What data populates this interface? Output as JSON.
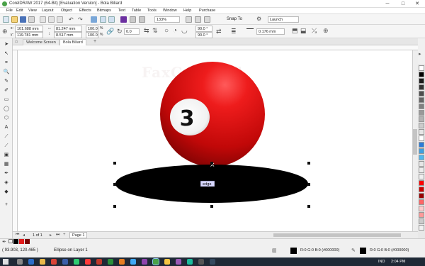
{
  "window": {
    "title": "CorelDRAW 2017 (64-Bit) [Evaluation Version] - Bola Biliard",
    "min_glyph": "─",
    "max_glyph": "□",
    "close_glyph": "✕"
  },
  "menu": [
    "File",
    "Edit",
    "View",
    "Layout",
    "Object",
    "Effects",
    "Bitmaps",
    "Text",
    "Table",
    "Tools",
    "Window",
    "Help",
    "Purchase"
  ],
  "toolbar": {
    "zoom_value": "133%",
    "snap_to_label": "Snap To",
    "launch_label": "Launch"
  },
  "property_bar": {
    "x_value": "101.688 mm",
    "y_value": "119.781 mm",
    "width_value": "81.247 mm",
    "height_value": "8.517 mm",
    "scale_x": "100.0",
    "scale_y": "100.0",
    "percent_sign": "%",
    "angle_value": "0.0",
    "start_angle": "90.0 °",
    "end_angle": "90.0 °",
    "outline_width": "0.176 mm"
  },
  "document_tabs": [
    {
      "label": "Welcome Screen",
      "active": false
    },
    {
      "label": "Bola Biliard",
      "active": true
    }
  ],
  "canvas": {
    "watermark_text": "FaxGraxa.id",
    "ball_number": "3",
    "cursor_tooltip": "edge",
    "ball_color": "#d01010",
    "shadow_color": "#000000"
  },
  "page_nav": {
    "page_count_label": "1 of 1",
    "page_tab_label": "Page 1"
  },
  "status": {
    "coordinates": "( 93.903, 120.465 )",
    "selection_info": "Ellipse on Layer 1",
    "fill_label": "R:0 G:0 B:0 (#000000)",
    "outline_label": "R:0 G:0 B:0 (#000000)"
  },
  "taskbar": {
    "language": "IND",
    "time": "2:04 PM"
  },
  "palette_colors": [
    "#ffffff",
    "#000000",
    "#1a1a1a",
    "#333333",
    "#4d4d4d",
    "#666666",
    "#808080",
    "#999999",
    "#b3b3b3",
    "#cccccc",
    "#e6e6e6",
    "#ffffff",
    "#2b7bd8",
    "#3fa0e0",
    "#50b8f0",
    "#e6e6e6",
    "#ececec",
    "#f0f0f0",
    "#ff0000",
    "#cc0000",
    "#990000",
    "#ff6666",
    "#ffcccc",
    "#ff9999",
    "#cccccc",
    "#f2f2f2"
  ]
}
